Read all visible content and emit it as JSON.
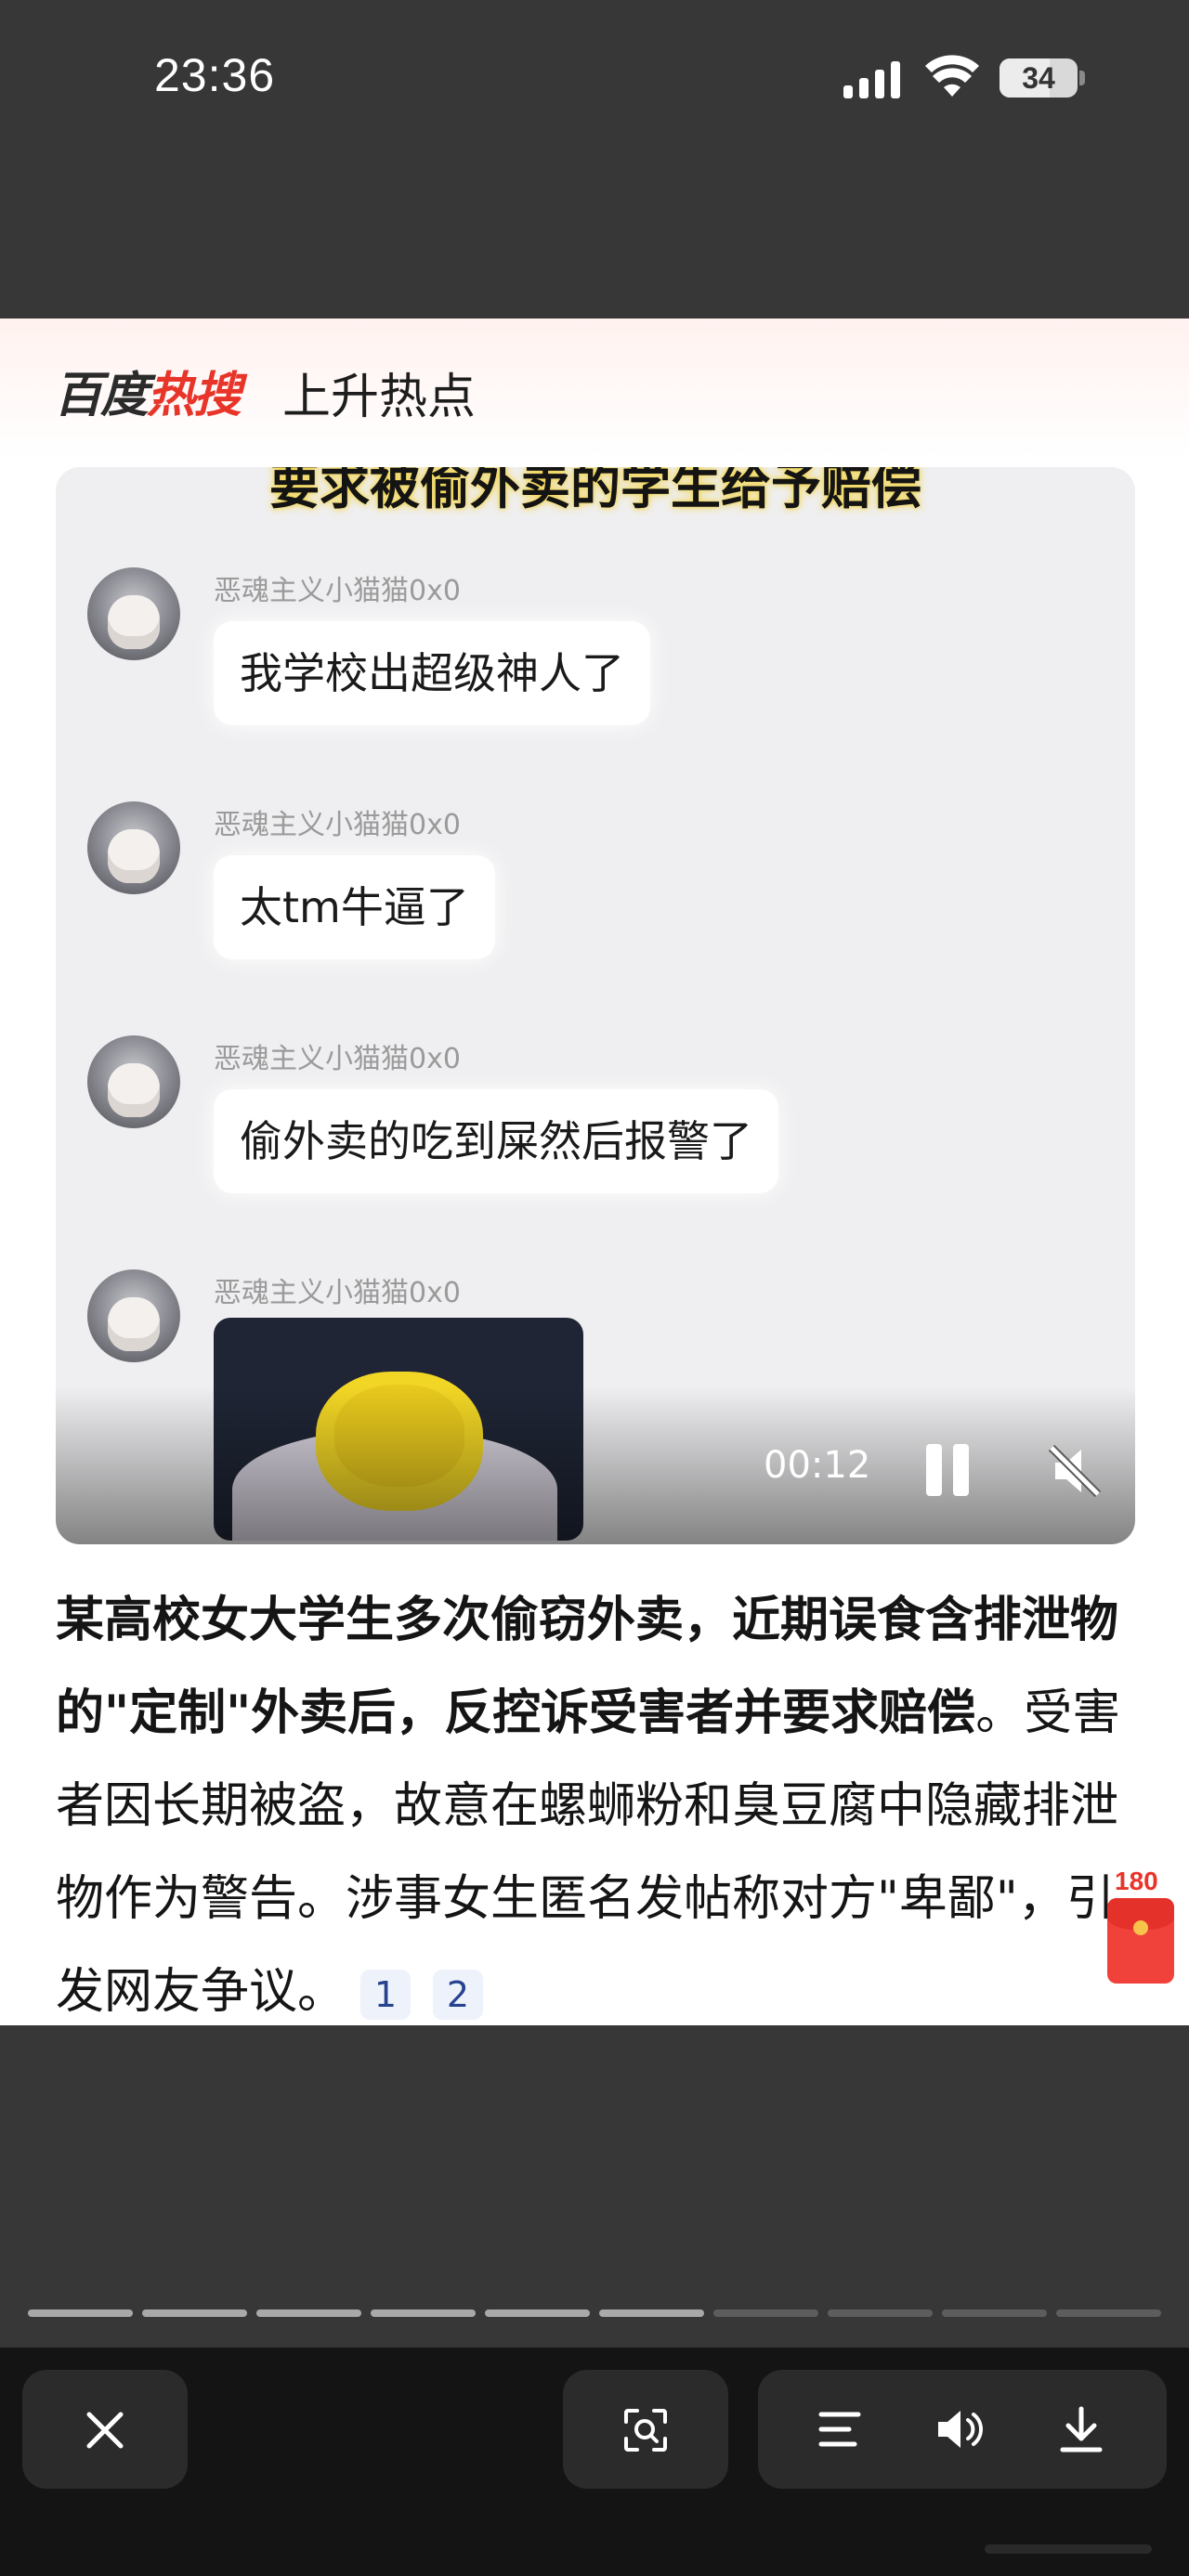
{
  "status_bar": {
    "time": "23:36",
    "battery": "34"
  },
  "header": {
    "brand_part1": "百度",
    "brand_part2": "热搜",
    "tagline": "上升热点"
  },
  "video": {
    "overlay_title": "要求被偷外卖的学生给予赔偿",
    "messages": [
      {
        "user": "恶魂主义小猫猫0x0",
        "text": "我学校出超级神人了"
      },
      {
        "user": "恶魂主义小猫猫0x0",
        "text": "太tm牛逼了"
      },
      {
        "user": "恶魂主义小猫猫0x0",
        "text": "偷外卖的吃到屎然后报警了"
      },
      {
        "user": "恶魂主义小猫猫0x0",
        "text": ""
      }
    ],
    "current_time": "00:12",
    "state": "playing",
    "muted": true
  },
  "summary": {
    "highlight": "某高校女大学生多次偷窃外卖，近期误食含排泄物的\"定制\"外卖后，反控诉受害者并要求赔偿",
    "body": "。受害者因长期被盗，故意在螺蛳粉和臭豆腐中隐藏排泄物作为警告。涉事女生匿名发帖称对方\"卑鄙\"，引发网友争议。",
    "refs": [
      "1",
      "2"
    ]
  },
  "red_packet": {
    "count": "180"
  },
  "progress": {
    "total_segments": 10,
    "completed_segments": 6
  },
  "toolbar": {
    "close_icon": "close-icon",
    "scan_icon": "scan-icon",
    "menu_icon": "menu-icon",
    "volume_icon": "volume-icon",
    "download_icon": "download-icon"
  }
}
